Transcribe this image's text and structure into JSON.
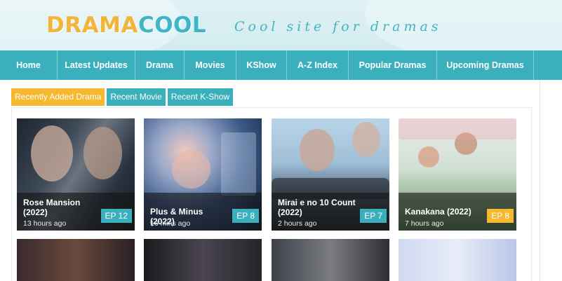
{
  "header": {
    "logo_part1": "DRAMA",
    "logo_part2": "COOL",
    "tagline": "Cool site for dramas"
  },
  "nav": {
    "items": [
      {
        "label": "Home"
      },
      {
        "label": "Latest Updates"
      },
      {
        "label": "Drama"
      },
      {
        "label": "Movies"
      },
      {
        "label": "KShow"
      },
      {
        "label": "A-Z Index"
      },
      {
        "label": "Popular Dramas"
      },
      {
        "label": "Upcoming Dramas"
      }
    ]
  },
  "tabs": [
    {
      "label": "Recently Added Drama",
      "active": true
    },
    {
      "label": "Recent Movie",
      "active": false
    },
    {
      "label": "Recent K-Show",
      "active": false
    }
  ],
  "cards": [
    {
      "title": "Rose Mansion (2022)",
      "time": "13 hours ago",
      "episode": "EP 12",
      "badge_color": "#3ab0bd"
    },
    {
      "title": "Plus & Minus (2022)",
      "time": "16 mins ago",
      "episode": "EP 8",
      "badge_color": "#3ab0bd"
    },
    {
      "title": "Mirai e no 10 Count (2022)",
      "time": "2 hours ago",
      "episode": "EP 7",
      "badge_color": "#3ab0bd"
    },
    {
      "title": "Kanakana (2022)",
      "time": "7 hours ago",
      "episode": "EP 8",
      "badge_color": "#f5b82e"
    }
  ],
  "colors": {
    "accent_teal": "#3ab0bd",
    "accent_orange": "#f5b82e"
  }
}
